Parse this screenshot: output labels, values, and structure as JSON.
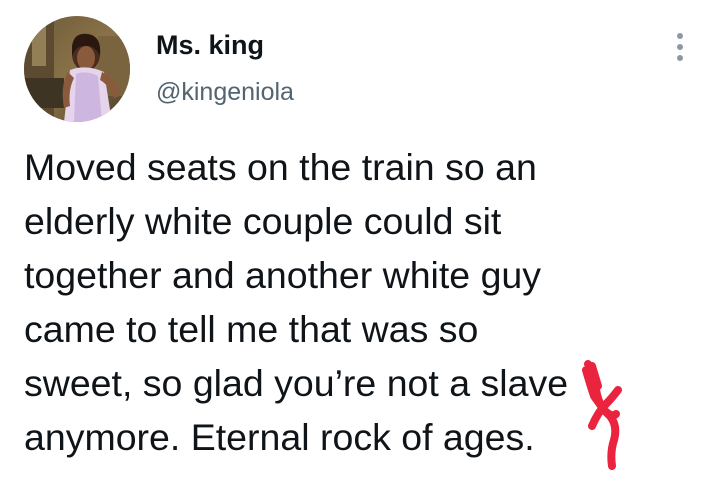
{
  "author": {
    "display_name": "Ms. king",
    "handle": "@kingeniola",
    "avatar_icon": "profile-photo"
  },
  "menu": {
    "icon": "more-vertical-icon"
  },
  "tweet": {
    "lines": [
      "Moved seats on the train so an",
      "elderly white couple could sit",
      "together and another white guy",
      "came to tell me that was so",
      "sweet, so glad you’re not a slave",
      "anymore. Eternal rock of ages."
    ]
  },
  "annotation": {
    "type": "red-marker-scribble",
    "color": "#e8102e"
  }
}
